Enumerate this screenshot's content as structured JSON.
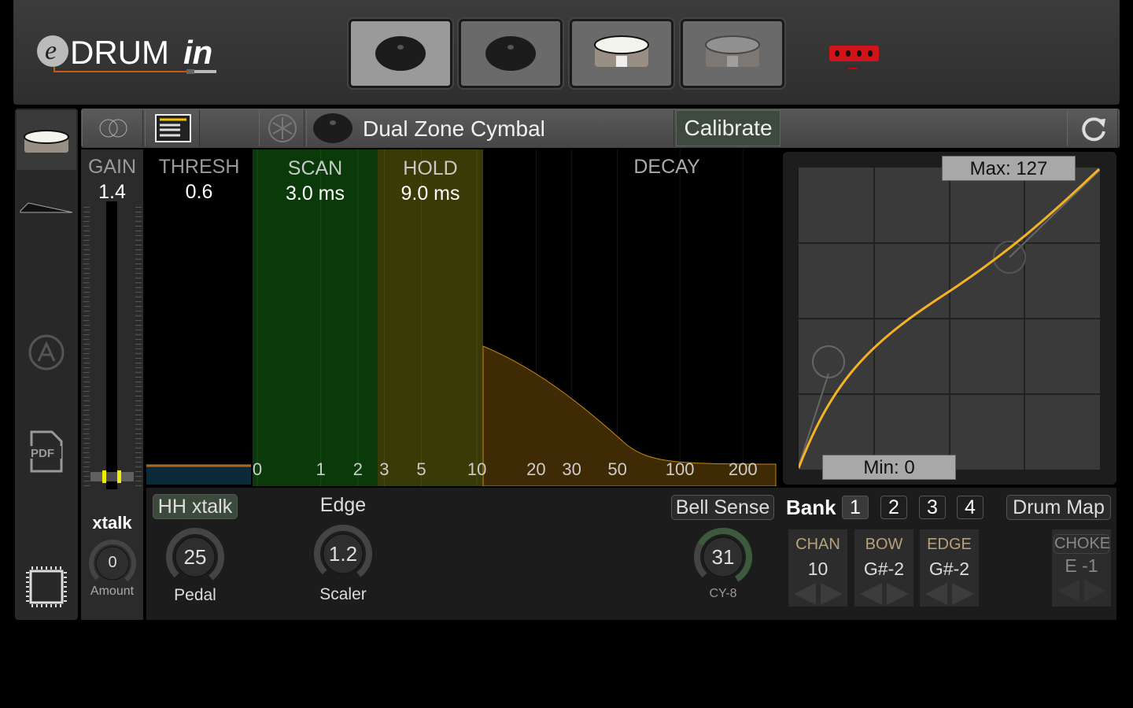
{
  "app": {
    "logo_text": "eDRUMin"
  },
  "header": {
    "pad_buttons": [
      {
        "name": "cymbal-1",
        "selected": true
      },
      {
        "name": "cymbal-2",
        "selected": false
      },
      {
        "name": "drum-1",
        "selected": false
      },
      {
        "name": "drum-2",
        "selected": false
      }
    ],
    "device_icon": "edrumin-device-icon",
    "device_color": "#d0141a"
  },
  "toolbar": {
    "pad_name": "Dual Zone Cymbal",
    "calibrate": "Calibrate",
    "refresh_icon": "refresh-icon"
  },
  "params": {
    "gain_label": "GAIN",
    "gain_value": "1.4",
    "thresh_label": "THRESH",
    "thresh_value": "0.6",
    "scan_label": "SCAN",
    "scan_value": "3.0 ms",
    "hold_label": "HOLD",
    "hold_value": "9.0 ms",
    "decay_label": "DECAY"
  },
  "decay_ticks": [
    "0",
    "1",
    "2",
    "3",
    "5",
    "10",
    "20",
    "30",
    "50",
    "100",
    "200"
  ],
  "curve": {
    "max_label": "Max: 127",
    "min_label": "Min: 0",
    "color": "#f5b324"
  },
  "xtalk": {
    "label": "xtalk",
    "value": "0",
    "sublabel": "Amount"
  },
  "hh_xtalk": {
    "label": "HH xtalk",
    "value": "25",
    "sublabel": "Pedal"
  },
  "edge": {
    "label": "Edge",
    "value": "1.2",
    "sublabel": "Scaler"
  },
  "bell": {
    "label": "Bell Sense",
    "value": "31",
    "sublabel": "CY-8"
  },
  "bank": {
    "label": "Bank",
    "buttons": [
      "1",
      "2",
      "3",
      "4"
    ],
    "selected": "1"
  },
  "drum_map": "Drum Map",
  "midi": {
    "chan": {
      "label": "CHAN",
      "value": "10"
    },
    "bow": {
      "label": "BOW",
      "value": "G#-2"
    },
    "edge": {
      "label": "EDGE",
      "value": "G#-2"
    },
    "choke": {
      "label": "CHOKE",
      "value": "E -1"
    }
  }
}
